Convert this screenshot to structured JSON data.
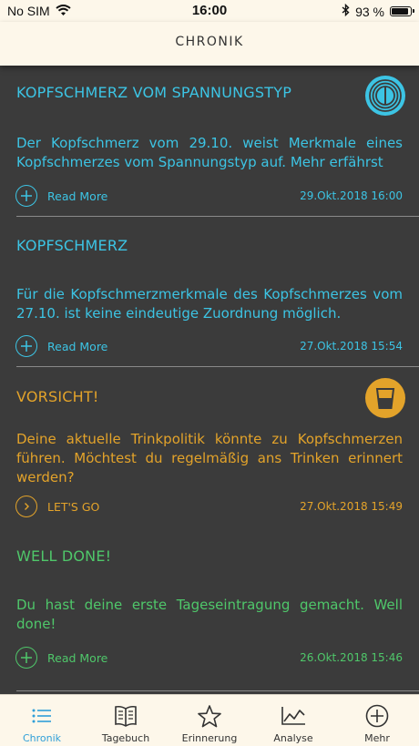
{
  "status_bar": {
    "carrier": "No SIM",
    "time": "16:00",
    "battery": "93 %",
    "battery_level": 0.93,
    "icons": [
      "wifi-icon",
      "bluetooth-icon",
      "battery-icon"
    ]
  },
  "header": {
    "title": "CHRONIK"
  },
  "colors": {
    "cyan": "#3cc4e4",
    "orange": "#e3a32a",
    "green": "#4fc76a",
    "background": "#3b3b3b",
    "bar_background": "#fdf7ea",
    "tab_active": "#2f9fd8",
    "tab_inactive": "#333333"
  },
  "cards": [
    {
      "title": "KOPFSCHMERZ VOM SPANNUNGSTYP",
      "body": "Der Kopfschmerz vom 29.10. weist Merkmale eines Kopfschmerzes vom Spannungstyp auf. Mehr erfährst",
      "action_label": "Read More",
      "action_icon": "plus-circle-icon",
      "date": "29.Okt.2018 16:00",
      "icon": "headache-badge-icon",
      "color": "#3cc4e4"
    },
    {
      "title": "KOPFSCHMERZ",
      "body": "Für die Kopfschmerzmerkmale des Kopfschmerzes vom 27.10. ist keine eindeutige Zuordnung möglich.",
      "action_label": "Read More",
      "action_icon": "plus-circle-icon",
      "date": "27.Okt.2018 15:54",
      "color": "#3cc4e4"
    },
    {
      "title": "VORSICHT!",
      "body": "Deine aktuelle Trinkpolitik könnte zu Kopfschmerzen führen. Möchtest du regelmäßig ans Trinken erinnert werden?",
      "action_label": "LET'S GO",
      "action_icon": "chevron-circle-icon",
      "date": "27.Okt.2018 15:49",
      "icon": "glass-badge-icon",
      "color": "#e3a32a"
    },
    {
      "title": "WELL DONE!",
      "body": "Du hast deine erste Tageseintragung gemacht. Well done!",
      "action_label": "Read More",
      "action_icon": "plus-circle-icon",
      "date": "26.Okt.2018 15:46",
      "color": "#4fc76a"
    }
  ],
  "tabs": [
    {
      "label": "Chronik",
      "icon": "list-icon",
      "active": true
    },
    {
      "label": "Tagebuch",
      "icon": "book-icon",
      "active": false
    },
    {
      "label": "Erinnerung",
      "icon": "star-icon",
      "active": false
    },
    {
      "label": "Analyse",
      "icon": "chart-icon",
      "active": false
    },
    {
      "label": "Mehr",
      "icon": "plus-circle-icon",
      "active": false
    }
  ]
}
